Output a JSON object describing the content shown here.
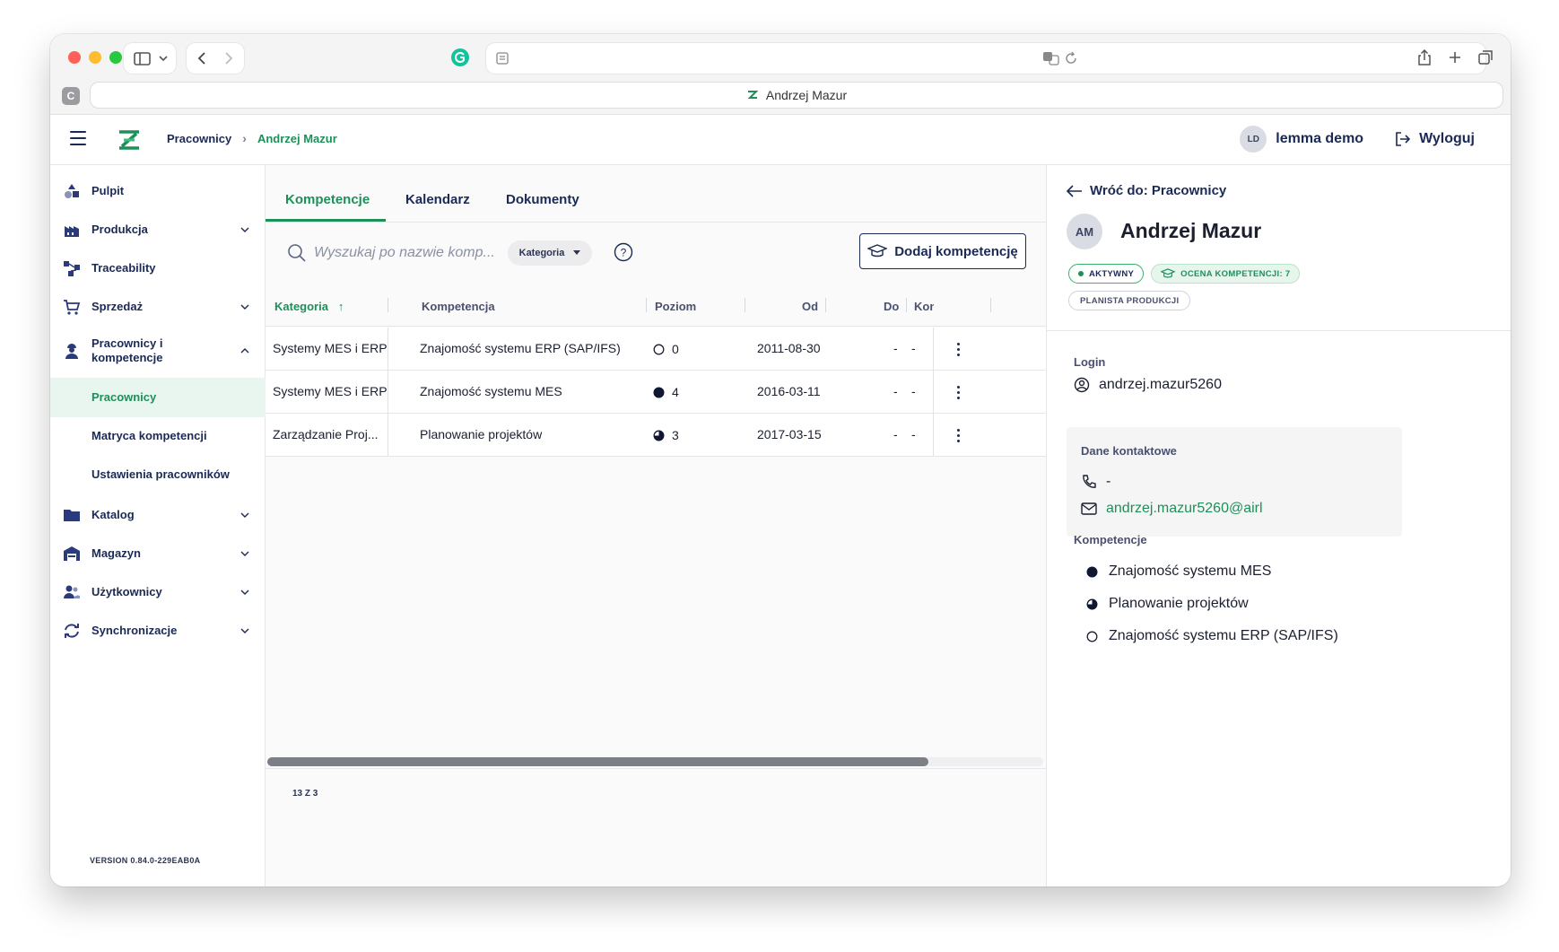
{
  "browser": {
    "tab_title": "Andrzej Mazur",
    "favicon_letter": "C"
  },
  "header": {
    "breadcrumb": [
      "Pracownicy",
      "Andrzej Mazur"
    ],
    "user_initials": "LD",
    "user_name": "lemma demo",
    "logout_label": "Wyloguj"
  },
  "sidebar": {
    "items": [
      {
        "label": "Pulpit",
        "icon": "shapes-icon"
      },
      {
        "label": "Produkcja",
        "icon": "factory-icon"
      },
      {
        "label": "Traceability",
        "icon": "network-icon"
      },
      {
        "label": "Sprzedaż",
        "icon": "cart-icon"
      },
      {
        "label": "Pracownicy i kompetencje",
        "icon": "worker-icon"
      },
      {
        "label": "Katalog",
        "icon": "folder-icon"
      },
      {
        "label": "Magazyn",
        "icon": "warehouse-icon"
      },
      {
        "label": "Użytkownicy",
        "icon": "users-icon"
      },
      {
        "label": "Synchronizacje",
        "icon": "sync-icon"
      }
    ],
    "subitems": [
      {
        "label": "Pracownicy",
        "active": true
      },
      {
        "label": "Matryca kompetencji",
        "active": false
      },
      {
        "label": "Ustawienia pracowników",
        "active": false
      }
    ],
    "version": "VERSION 0.84.0-229EAB0A"
  },
  "main": {
    "tabs": [
      "Kompetencje",
      "Kalendarz",
      "Dokumenty"
    ],
    "active_tab": "Kompetencje",
    "search_placeholder": "Wyszukaj po nazwie komp...",
    "category_filter": "Kategoria",
    "add_button": "Dodaj kompetencję",
    "columns": [
      "Kategoria",
      "Kompetencja",
      "Poziom",
      "Od",
      "Do",
      "Kon"
    ],
    "rows": [
      {
        "kategoria": "Systemy MES i ERP",
        "kompetencja": "Znajomość systemu ERP (SAP/IFS)",
        "poziom": "0",
        "level_fill": "empty",
        "od": "2011-08-30",
        "do": "-",
        "kon": "-"
      },
      {
        "kategoria": "Systemy MES i ERP",
        "kompetencja": "Znajomość systemu MES",
        "poziom": "4",
        "level_fill": "full",
        "od": "2016-03-11",
        "do": "-",
        "kon": "-"
      },
      {
        "kategoria": "Zarządzanie Proj...",
        "kompetencja": "Planowanie projektów",
        "poziom": "3",
        "level_fill": "three-quarter",
        "od": "2017-03-15",
        "do": "-",
        "kon": "-"
      }
    ],
    "pagination": "13 Z 3"
  },
  "panel": {
    "back_link": "Wróć do: Pracownicy",
    "avatar_initials": "AM",
    "name": "Andrzej Mazur",
    "status_badge": "AKTYWNY",
    "score_badge": "OCENA KOMPETENCJI: 7",
    "role_badge": "PLANISTA PRODUKCJI",
    "login_label": "Login",
    "login_value": "andrzej.mazur5260",
    "contact_label": "Dane kontaktowe",
    "phone_value": "-",
    "email_value": "andrzej.mazur5260@airl",
    "competences_label": "Kompetencje",
    "competences": [
      {
        "name": "Znajomość systemu MES",
        "level_fill": "full"
      },
      {
        "name": "Planowanie projektów",
        "level_fill": "three-quarter"
      },
      {
        "name": "Znajomość systemu ERP (SAP/IFS)",
        "level_fill": "empty"
      }
    ]
  },
  "colors": {
    "brand_green": "#1f8f5a",
    "navy": "#1b2a55"
  }
}
